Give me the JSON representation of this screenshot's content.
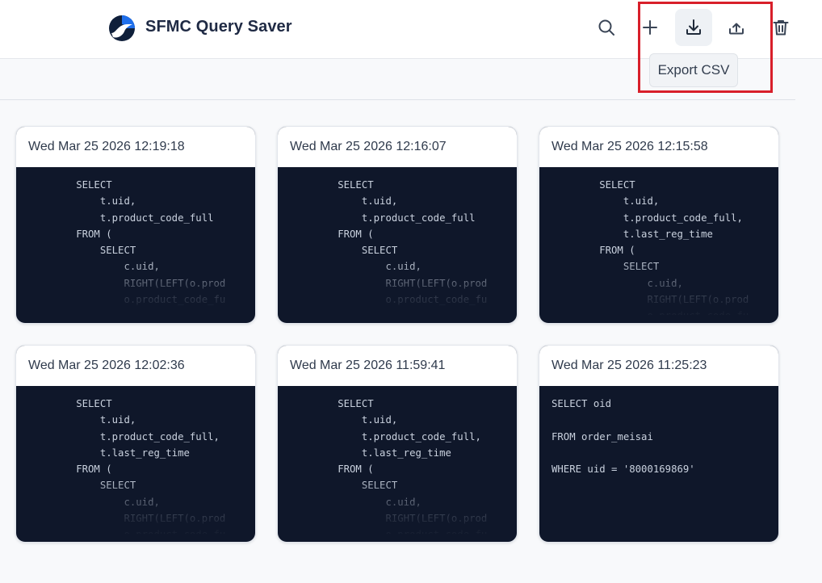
{
  "app": {
    "title": "SFMC Query Saver",
    "brand_color": "#1f6feb"
  },
  "toolbar": {
    "search_icon": "search-icon",
    "add_icon": "plus-icon",
    "export_icon": "download-icon",
    "import_icon": "upload-icon",
    "delete_icon": "trash-icon",
    "tooltip": "Export CSV"
  },
  "colors": {
    "highlight": "#d81f2a",
    "code_bg": "#0f172a"
  },
  "queries": [
    {
      "timestamp": "Wed Mar 25 2026 12:19:18",
      "code": "        SELECT\n            t.uid,\n            t.product_code_full\n        FROM (\n            SELECT\n                c.uid,\n                RIGHT(LEFT(o.prod\n                o.product_code_fu"
    },
    {
      "timestamp": "Wed Mar 25 2026 12:16:07",
      "code": "        SELECT\n            t.uid,\n            t.product_code_full\n        FROM (\n            SELECT\n                c.uid,\n                RIGHT(LEFT(o.prod\n                o.product_code_fu"
    },
    {
      "timestamp": "Wed Mar 25 2026 12:15:58",
      "code": "        SELECT\n            t.uid,\n            t.product_code_full,\n            t.last_reg_time\n        FROM (\n            SELECT\n                c.uid,\n                RIGHT(LEFT(o.prod\n                o.product_code_fu"
    },
    {
      "timestamp": "Wed Mar 25 2026 12:02:36",
      "code": "        SELECT\n            t.uid,\n            t.product_code_full,\n            t.last_reg_time\n        FROM (\n            SELECT\n                c.uid,\n                RIGHT(LEFT(o.prod\n                o.product_code_fu"
    },
    {
      "timestamp": "Wed Mar 25 2026 11:59:41",
      "code": "        SELECT\n            t.uid,\n            t.product_code_full,\n            t.last_reg_time\n        FROM (\n            SELECT\n                c.uid,\n                RIGHT(LEFT(o.prod\n                o.product_code_fu"
    },
    {
      "timestamp": "Wed Mar 25 2026 11:25:23",
      "code": "SELECT oid\n\nFROM order_meisai\n\nWHERE uid = '8000169869'"
    }
  ]
}
